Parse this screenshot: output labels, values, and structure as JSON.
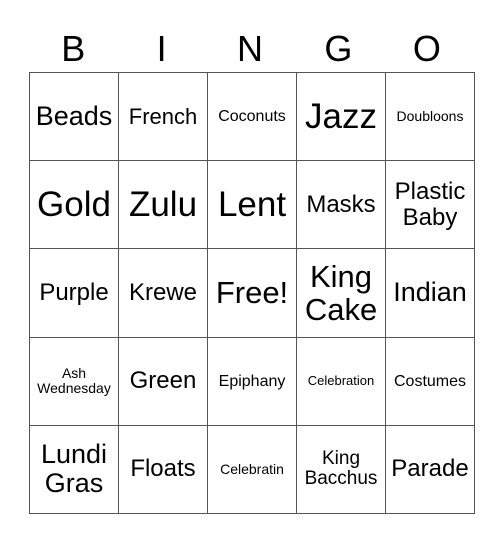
{
  "header": [
    "B",
    "I",
    "N",
    "G",
    "O"
  ],
  "rows": [
    [
      "Beads",
      "French",
      "Coconuts",
      "Jazz",
      "Doubloons"
    ],
    [
      "Gold",
      "Zulu",
      "Lent",
      "Masks",
      "Plastic Baby"
    ],
    [
      "Purple",
      "Krewe",
      "Free!",
      "King Cake",
      "Indian"
    ],
    [
      "Ash Wednesday",
      "Green",
      "Epiphany",
      "Celebration",
      "Costumes"
    ],
    [
      "Lundi Gras",
      "Floats",
      "Celebratin",
      "King Bacchus",
      "Parade"
    ]
  ]
}
